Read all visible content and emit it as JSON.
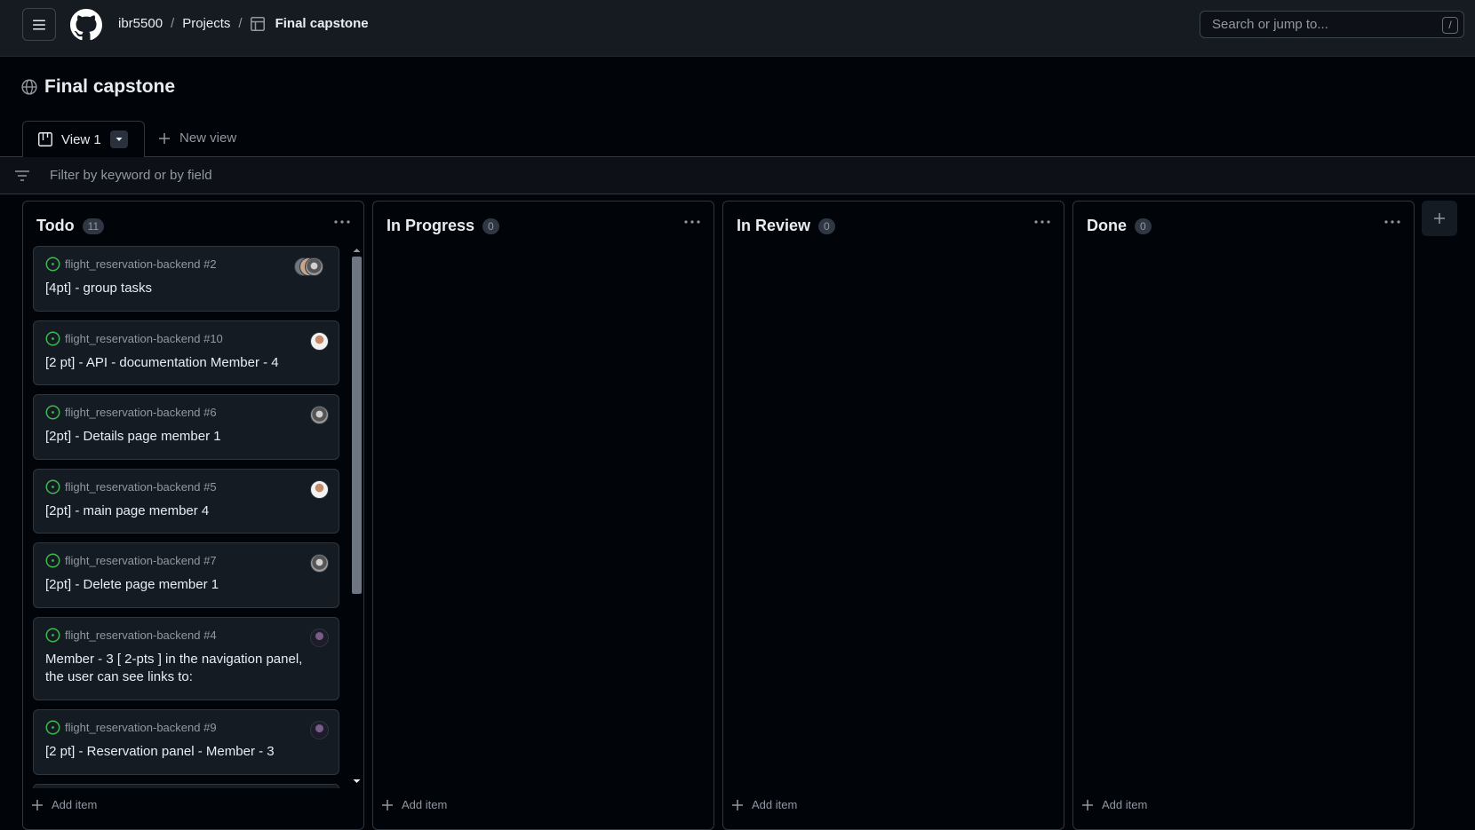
{
  "header": {
    "breadcrumb": {
      "owner": "ibr5500",
      "projects": "Projects",
      "separator": "/",
      "project": "Final capstone"
    },
    "search_placeholder": "Search or jump to...",
    "search_shortcut": "/"
  },
  "page": {
    "title": "Final capstone"
  },
  "tabs": {
    "active": "View 1",
    "new_view": "New view"
  },
  "filter": {
    "placeholder": "Filter by keyword or by field"
  },
  "columns": [
    {
      "name": "Todo",
      "count": "11",
      "add_item": "Add item"
    },
    {
      "name": "In Progress",
      "count": "0",
      "add_item": "Add item"
    },
    {
      "name": "In Review",
      "count": "0",
      "add_item": "Add item"
    },
    {
      "name": "Done",
      "count": "0",
      "add_item": "Add item"
    }
  ],
  "cards": [
    {
      "repo": "flight_reservation-backend #2",
      "title": "[4pt] - group tasks"
    },
    {
      "repo": "flight_reservation-backend #10",
      "title": "[2 pt] - API - documentation Member - 4"
    },
    {
      "repo": "flight_reservation-backend #6",
      "title": "[2pt] - Details page member 1"
    },
    {
      "repo": "flight_reservation-backend #5",
      "title": "[2pt] - main page member 4"
    },
    {
      "repo": "flight_reservation-backend #7",
      "title": "[2pt] - Delete page member 1"
    },
    {
      "repo": "flight_reservation-backend #4",
      "title": "Member - 3 [ 2-pts ] in the navigation panel, the user can see links to:"
    },
    {
      "repo": "flight_reservation-backend #9",
      "title": "[2 pt] - Reservation panel - Member - 3"
    }
  ],
  "colors": {
    "bg": "#010409",
    "header_bg": "#161b22",
    "card_bg": "#151b23",
    "border": "#30363d",
    "open_issue": "#3fb950",
    "muted": "#9198a1"
  }
}
